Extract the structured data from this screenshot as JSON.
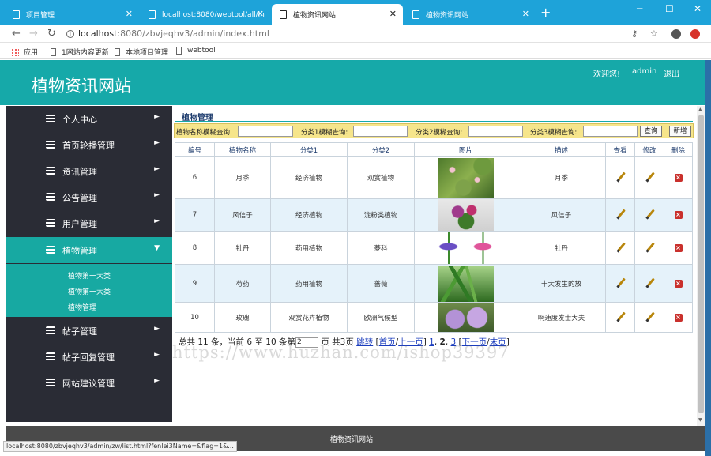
{
  "browser": {
    "tabs": [
      {
        "label": "项目管理",
        "active": false
      },
      {
        "label": "localhost:8080/webtool/all/in",
        "active": false
      },
      {
        "label": "植物资讯网站",
        "active": true
      },
      {
        "label": "植物资讯网站",
        "active": false
      }
    ],
    "new_tab": "+",
    "url_host": "localhost",
    "url_path": ":8080/zbvjeqhv3/admin/index.html",
    "bookmarks": [
      {
        "label": "应用",
        "icon": "apps-grid-icon"
      },
      {
        "label": "1网站内容更新",
        "icon": "page-icon"
      },
      {
        "label": "本地项目管理",
        "icon": "page-icon"
      },
      {
        "label": "webtool",
        "icon": "page-icon"
      }
    ],
    "status_url": "localhost:8080/zbvjeqhv3/admin/zw/list.html?fenlei3Name=&flag=1&..."
  },
  "header": {
    "site_title": "植物资讯网站",
    "welcome": "欢迎您!",
    "username": "admin",
    "logout": "退出"
  },
  "sidebar": {
    "items": [
      {
        "label": "个人中心",
        "arrow": "►"
      },
      {
        "label": "首页轮播管理",
        "arrow": "►"
      },
      {
        "label": "资讯管理",
        "arrow": "►"
      },
      {
        "label": "公告管理",
        "arrow": "►"
      },
      {
        "label": "用户管理",
        "arrow": "►"
      },
      {
        "label": "植物管理",
        "arrow": "▼"
      },
      {
        "label": "帖子管理",
        "arrow": "►"
      },
      {
        "label": "帖子回复管理",
        "arrow": "►"
      },
      {
        "label": "网站建议管理",
        "arrow": "►"
      }
    ],
    "subitems": [
      "植物第一大类",
      "植物第一大类",
      "植物管理"
    ]
  },
  "main": {
    "title": "植物管理",
    "search": {
      "label1": "植物名称模糊查询:",
      "label2": "分类1模糊查询:",
      "label3": "分类2模糊查询:",
      "label4": "分类3模糊查询:",
      "query_btn": "查询",
      "add_btn": "新增"
    },
    "table": {
      "headers": [
        "编号",
        "植物名称",
        "分类1",
        "分类2",
        "图片",
        "描述",
        "查看",
        "修改",
        "删除"
      ],
      "rows": [
        {
          "id": "6",
          "name": "月季",
          "cat1": "经济植物",
          "cat2": "观赏植物",
          "desc": "月季",
          "img": "lily-pond-image"
        },
        {
          "id": "7",
          "name": "风信子",
          "cat1": "经济植物",
          "cat2": "淀粉类植物",
          "desc": "风信子",
          "img": "purple-flowers-image"
        },
        {
          "id": "8",
          "name": "牡丹",
          "cat1": "药用植物",
          "cat2": "菱科",
          "desc": "牡丹",
          "img": "hyacinth-image"
        },
        {
          "id": "9",
          "name": "芍药",
          "cat1": "药用植物",
          "cat2": "蔷薇",
          "desc": "十大发生的放",
          "img": "green-leaves-image"
        },
        {
          "id": "10",
          "name": "玫瑰",
          "cat1": "观赏花卉植物",
          "cat2": "欧洲气候型",
          "desc": "啊速度发士大夫",
          "img": "pink-mallow-image"
        }
      ]
    },
    "pager": {
      "total_prefix": "总共",
      "total": "11",
      "total_suffix": "条，当前",
      "from": "6",
      "to_word": "至",
      "to": "10",
      "unit": "条第",
      "page_input": "2",
      "page_word": "页 共3页",
      "jump": "跳转",
      "first": "首页",
      "prev": "上一页",
      "p1": "1",
      "p2": "2",
      "p3": "3",
      "next": "下一页",
      "last": "末页"
    },
    "watermark": "https://www.huzhan.com/ishop39397"
  },
  "footer": {
    "text": "植物资讯网站"
  },
  "colors": {
    "accent": "#16a9a9",
    "sidebar_bg": "#2a2c35",
    "search_bg": "#f6e58b",
    "tab_bar": "#1ea3d9"
  }
}
